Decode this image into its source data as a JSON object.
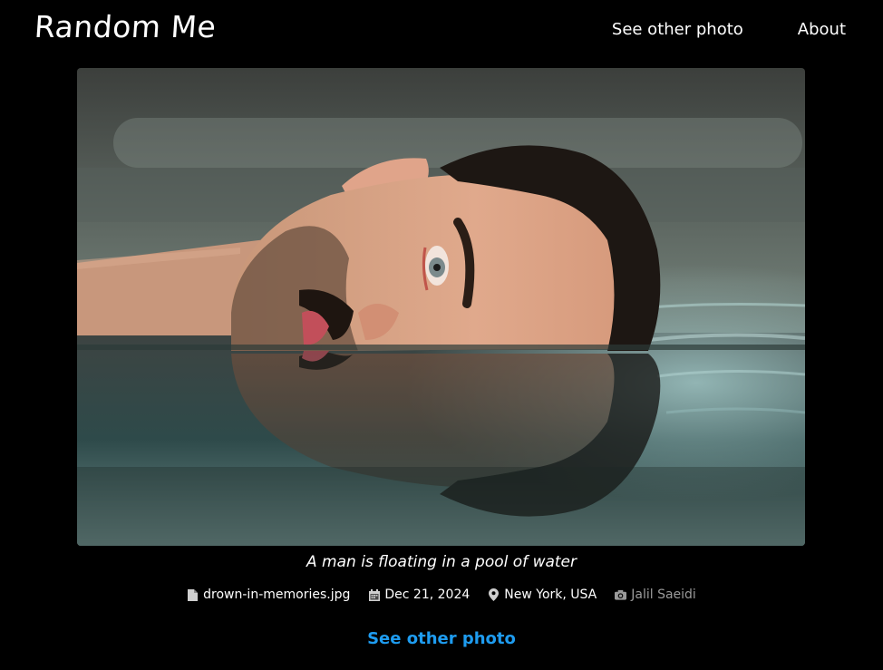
{
  "header": {
    "logo": "Random Me",
    "nav": {
      "see_other": "See other photo",
      "about": "About"
    }
  },
  "photo": {
    "caption": "A man is floating in a pool of water"
  },
  "meta": {
    "filename": "drown-in-memories.jpg",
    "date": "Dec 21, 2024",
    "location": "New York, USA",
    "author": "Jalil Saeidi",
    "icons": [
      "file-icon",
      "calendar-icon",
      "location-pin-icon",
      "camera-icon"
    ]
  },
  "cta": {
    "label": "See other photo"
  },
  "colors": {
    "background": "#000000",
    "link_accent": "#1e9cf0",
    "author_text": "#9a9a9a"
  }
}
